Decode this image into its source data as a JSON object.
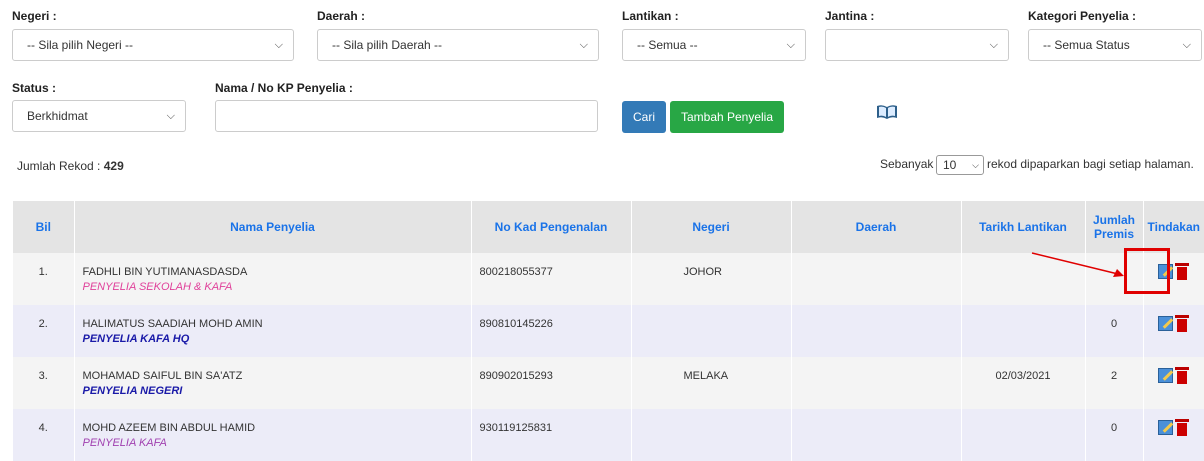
{
  "filters": {
    "negeri": {
      "label": "Negeri :",
      "value": "-- Sila pilih Negeri --"
    },
    "daerah": {
      "label": "Daerah :",
      "value": "-- Sila pilih Daerah --"
    },
    "lantikan": {
      "label": "Lantikan :",
      "value": "-- Semua --"
    },
    "jantina": {
      "label": "Jantina :",
      "value": ""
    },
    "kategori": {
      "label": "Kategori Penyelia :",
      "value": "-- Semua Status"
    },
    "status": {
      "label": "Status :",
      "value": "Berkhidmat"
    },
    "nama": {
      "label": "Nama / No KP Penyelia :",
      "value": ""
    }
  },
  "buttons": {
    "cari": "Cari",
    "tambah": "Tambah Penyelia"
  },
  "records": {
    "label": "Jumlah Rekod :",
    "count": "429",
    "per_page_prefix": "Sebanyak",
    "per_page_value": "10",
    "per_page_suffix": "rekod dipaparkan bagi setiap halaman."
  },
  "table": {
    "headers": {
      "bil": "Bil",
      "nama": "Nama Penyelia",
      "nokp": "No Kad Pengenalan",
      "negeri": "Negeri",
      "daerah": "Daerah",
      "tarikh": "Tarikh Lantikan",
      "premis": "Jumlah Premis",
      "tindakan": "Tindakan"
    },
    "rows": [
      {
        "bil": "1.",
        "nama": "FADHLI BIN YUTIMANASDASDA",
        "kategori": "PENYELIA SEKOLAH & KAFA",
        "kategori_color": "#e0409a",
        "nokp": "800218055377",
        "negeri": "JOHOR",
        "daerah": "",
        "tarikh": "",
        "premis": ""
      },
      {
        "bil": "2.",
        "nama": "HALIMATUS SAADIAH MOHD AMIN",
        "kategori": "PENYELIA KAFA HQ",
        "kategori_color": "#1a1aa8",
        "nokp": "890810145226",
        "negeri": "",
        "daerah": "",
        "tarikh": "",
        "premis": "0"
      },
      {
        "bil": "3.",
        "nama": "MOHAMAD SAIFUL BIN SA'ATZ",
        "kategori": "PENYELIA NEGERI",
        "kategori_color": "#1a1aa8",
        "nokp": "890902015293",
        "negeri": "MELAKA",
        "daerah": "",
        "tarikh": "02/03/2021",
        "premis": "2"
      },
      {
        "bil": "4.",
        "nama": "MOHD AZEEM BIN ABDUL HAMID",
        "kategori": "PENYELIA KAFA",
        "kategori_color": "#a040b0",
        "nokp": "930119125831",
        "negeri": "",
        "daerah": "",
        "tarikh": "",
        "premis": "0"
      }
    ]
  },
  "colors": {
    "accent": "#1a73e8",
    "cari": "#337ab7",
    "tambah": "#28a745",
    "annotation": "#e00000"
  }
}
